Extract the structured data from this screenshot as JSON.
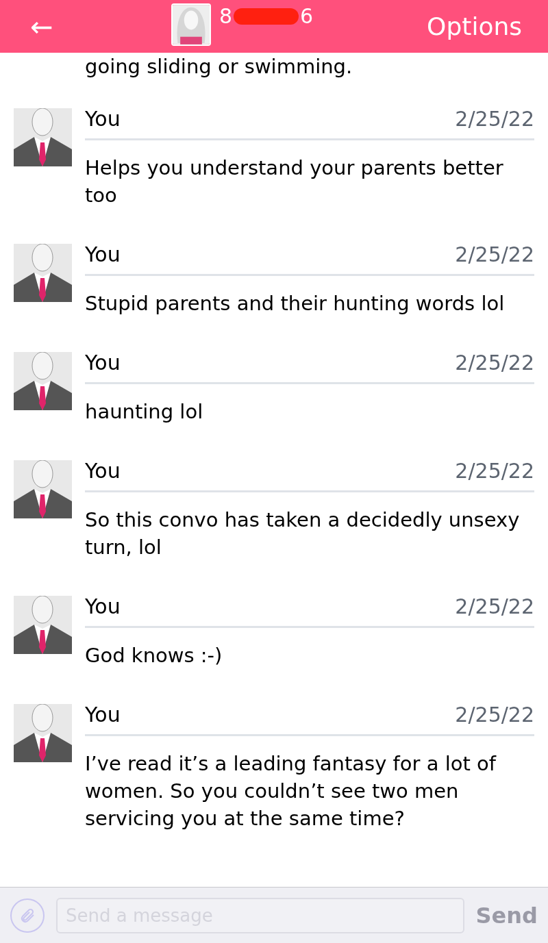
{
  "header": {
    "back": "←",
    "title_start": "8",
    "title_end": "6",
    "options": "Options"
  },
  "partial_message": "going sliding or swimming.",
  "messages": [
    {
      "sender": "You",
      "date": "2/25/22",
      "text": "Helps you understand your parents better too"
    },
    {
      "sender": "You",
      "date": "2/25/22",
      "text": "Stupid parents and their hunting words lol"
    },
    {
      "sender": "You",
      "date": "2/25/22",
      "text": "haunting lol"
    },
    {
      "sender": "You",
      "date": "2/25/22",
      "text": "So this convo has taken a decidedly unsexy turn, lol"
    },
    {
      "sender": "You",
      "date": "2/25/22",
      "text": "God knows :-)"
    },
    {
      "sender": "You",
      "date": "2/25/22",
      "text": "I’ve read it’s a leading fantasy for a lot of women. So you couldn’t see two men servicing you at the same time?"
    }
  ],
  "composer": {
    "placeholder": "Send a message",
    "send": "Send",
    "send_disabled": true
  }
}
